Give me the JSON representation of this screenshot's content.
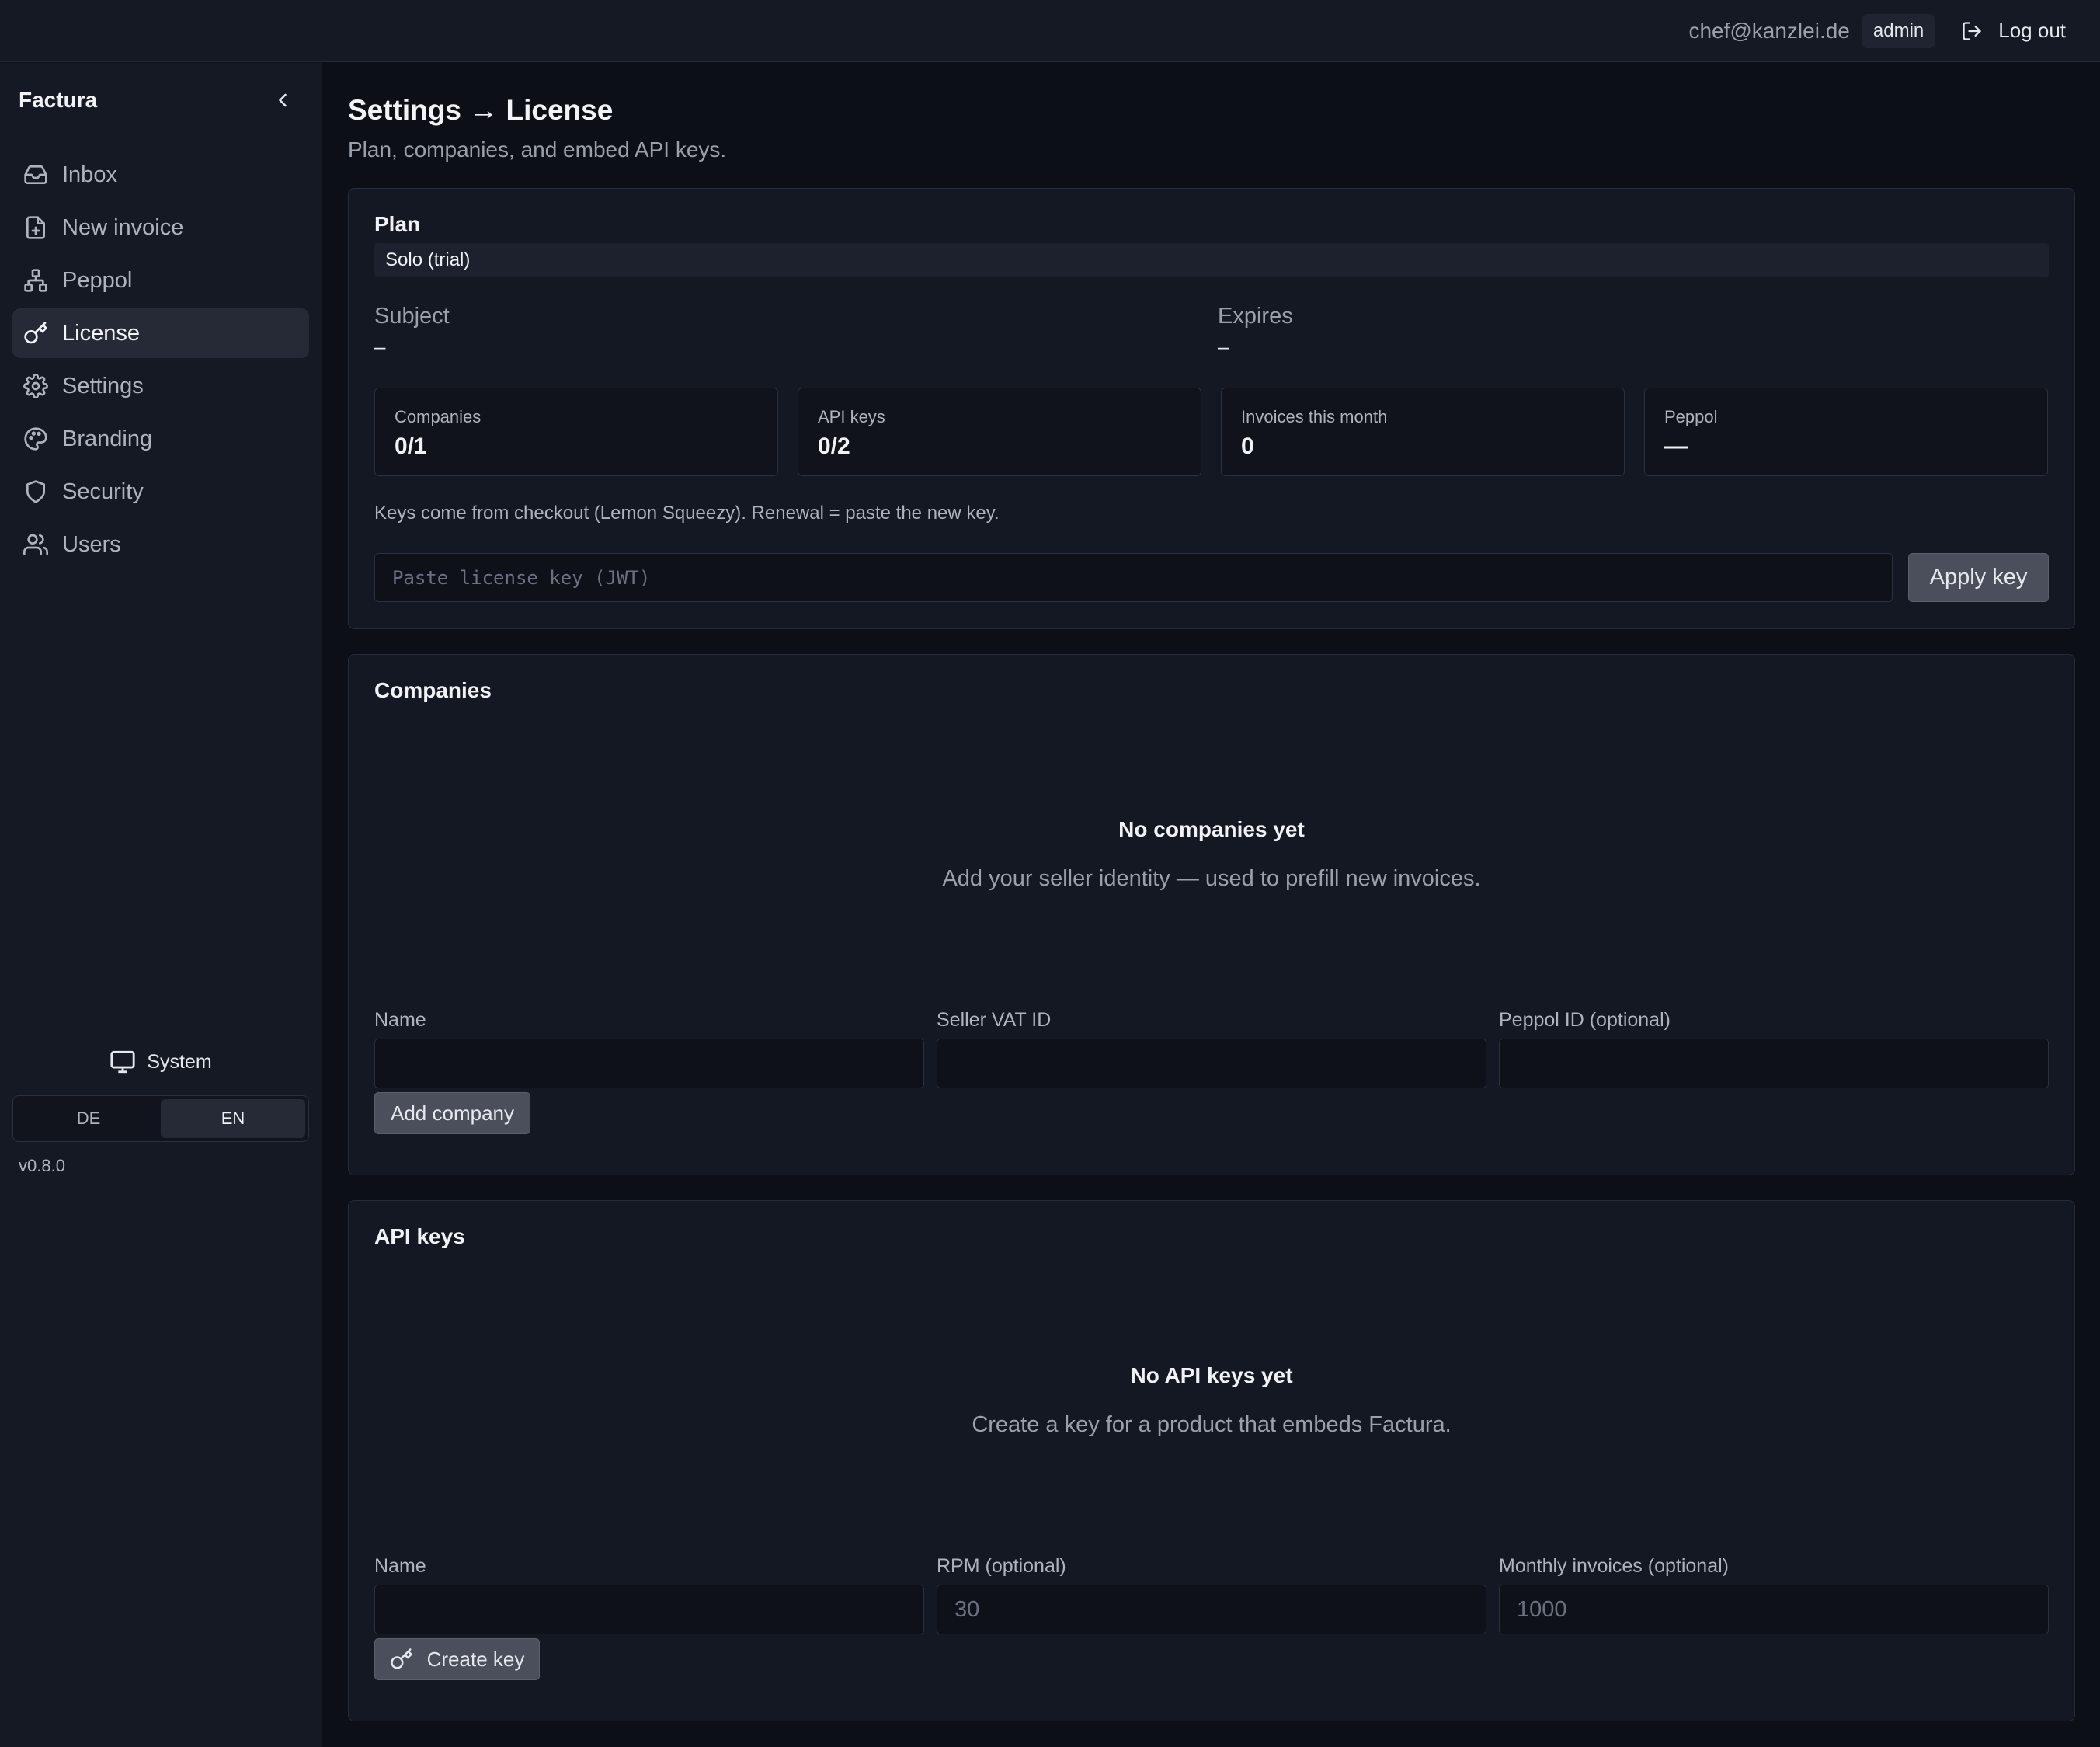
{
  "topbar": {
    "email": "chef@kanzlei.de",
    "role": "admin",
    "logout_label": "Log out"
  },
  "sidebar": {
    "brand": "Factura",
    "items": [
      {
        "label": "Inbox",
        "icon": "inbox-icon"
      },
      {
        "label": "New invoice",
        "icon": "file-plus-icon"
      },
      {
        "label": "Peppol",
        "icon": "network-icon"
      },
      {
        "label": "License",
        "icon": "key-icon",
        "active": true
      },
      {
        "label": "Settings",
        "icon": "gear-icon"
      },
      {
        "label": "Branding",
        "icon": "palette-icon"
      },
      {
        "label": "Security",
        "icon": "shield-icon"
      },
      {
        "label": "Users",
        "icon": "users-icon"
      }
    ],
    "theme_label": "System",
    "languages": [
      "DE",
      "EN"
    ],
    "active_language": "EN",
    "version": "v0.8.0"
  },
  "page": {
    "title": "Settings → License",
    "subtitle": "Plan, companies, and embed API keys."
  },
  "plan": {
    "heading": "Plan",
    "badge": "Solo (trial)",
    "subject_label": "Subject",
    "subject_value": "–",
    "expires_label": "Expires",
    "expires_value": "–",
    "stats": [
      {
        "label": "Companies",
        "value": "0/1"
      },
      {
        "label": "API keys",
        "value": "0/2"
      },
      {
        "label": "Invoices this month",
        "value": "0"
      },
      {
        "label": "Peppol",
        "value": "—"
      }
    ],
    "note": "Keys come from checkout (Lemon Squeezy). Renewal = paste the new key.",
    "key_placeholder": "Paste license key (JWT)",
    "apply_label": "Apply key"
  },
  "companies": {
    "heading": "Companies",
    "empty_title": "No companies yet",
    "empty_sub": "Add your seller identity — used to prefill new invoices.",
    "fields": [
      {
        "label": "Name",
        "placeholder": ""
      },
      {
        "label": "Seller VAT ID",
        "placeholder": ""
      },
      {
        "label": "Peppol ID (optional)",
        "placeholder": ""
      }
    ],
    "add_label": "Add company"
  },
  "api_keys": {
    "heading": "API keys",
    "empty_title": "No API keys yet",
    "empty_sub": "Create a key for a product that embeds Factura.",
    "fields": [
      {
        "label": "Name",
        "placeholder": ""
      },
      {
        "label": "RPM (optional)",
        "placeholder": "30"
      },
      {
        "label": "Monthly invoices (optional)",
        "placeholder": "1000"
      }
    ],
    "create_label": "Create key"
  },
  "colors": {
    "background": "#0d0f16",
    "panel": "#151924",
    "card": "#141823",
    "button": "#4a4f5b",
    "active_nav": "#252a36"
  }
}
